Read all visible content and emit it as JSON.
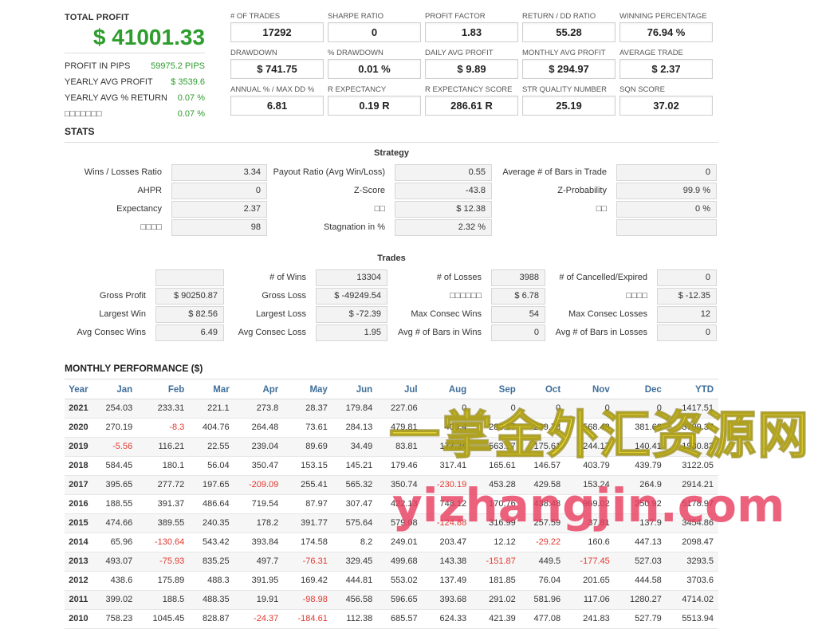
{
  "summary": {
    "total_profit_label": "TOTAL PROFIT",
    "total_profit_value": "$ 41001.33",
    "rows": [
      {
        "label": "PROFIT IN PIPS",
        "value": "59975.2 PIPS"
      },
      {
        "label": "YEARLY AVG PROFIT",
        "value": "$ 3539.6"
      },
      {
        "label": "YEARLY AVG % RETURN",
        "value": "0.07 %"
      },
      {
        "label": "□□□□□□□",
        "value": "0.07 %"
      }
    ]
  },
  "metrics": [
    {
      "label": "# OF TRADES",
      "value": "17292"
    },
    {
      "label": "SHARPE RATIO",
      "value": "0"
    },
    {
      "label": "PROFIT FACTOR",
      "value": "1.83"
    },
    {
      "label": "RETURN / DD RATIO",
      "value": "55.28"
    },
    {
      "label": "WINNING PERCENTAGE",
      "value": "76.94 %"
    },
    {
      "label": "DRAWDOWN",
      "value": "$ 741.75"
    },
    {
      "label": "% DRAWDOWN",
      "value": "0.01 %"
    },
    {
      "label": "DAILY AVG PROFIT",
      "value": "$ 9.89"
    },
    {
      "label": "MONTHLY AVG PROFIT",
      "value": "$ 294.97"
    },
    {
      "label": "AVERAGE TRADE",
      "value": "$ 2.37"
    },
    {
      "label": "ANNUAL % / MAX DD %",
      "value": "6.81"
    },
    {
      "label": "R EXPECTANCY",
      "value": "0.19 R"
    },
    {
      "label": "R EXPECTANCY SCORE",
      "value": "286.61 R"
    },
    {
      "label": "STR QUALITY NUMBER",
      "value": "25.19"
    },
    {
      "label": "SQN SCORE",
      "value": "37.02"
    }
  ],
  "stats": {
    "title": "STATS",
    "strategy_title": "Strategy",
    "strategy": [
      {
        "label": "Wins / Losses Ratio",
        "value": "3.34"
      },
      {
        "label": "Payout Ratio (Avg Win/Loss)",
        "value": "0.55"
      },
      {
        "label": "Average # of Bars in Trade",
        "value": "0"
      },
      {
        "label": "AHPR",
        "value": "0"
      },
      {
        "label": "Z-Score",
        "value": "-43.8"
      },
      {
        "label": "Z-Probability",
        "value": "99.9 %"
      },
      {
        "label": "Expectancy",
        "value": "2.37"
      },
      {
        "label": "□□",
        "value": "$ 12.38"
      },
      {
        "label": "□□",
        "value": "0 %"
      },
      {
        "label": "□□□□",
        "value": "98"
      },
      {
        "label": "Stagnation in %",
        "value": "2.32 %"
      },
      {
        "label": "",
        "value": ""
      }
    ],
    "trades_title": "Trades",
    "trades": [
      {
        "label": "",
        "value": ""
      },
      {
        "label": "# of Wins",
        "value": "13304"
      },
      {
        "label": "# of Losses",
        "value": "3988"
      },
      {
        "label": "# of Cancelled/Expired",
        "value": "0"
      },
      {
        "label": "Gross Profit",
        "value": "$ 90250.87"
      },
      {
        "label": "Gross Loss",
        "value": "$ -49249.54"
      },
      {
        "label": "□□□□□□",
        "value": "$ 6.78"
      },
      {
        "label": "□□□□",
        "value": "$ -12.35"
      },
      {
        "label": "Largest Win",
        "value": "$ 82.56"
      },
      {
        "label": "Largest Loss",
        "value": "$ -72.39"
      },
      {
        "label": "Max Consec Wins",
        "value": "54"
      },
      {
        "label": "Max Consec Losses",
        "value": "12"
      },
      {
        "label": "Avg Consec Wins",
        "value": "6.49"
      },
      {
        "label": "Avg Consec Loss",
        "value": "1.95"
      },
      {
        "label": "Avg # of Bars in Wins",
        "value": "0"
      },
      {
        "label": "Avg # of Bars in Losses",
        "value": "0"
      }
    ]
  },
  "monthly": {
    "title": "MONTHLY PERFORMANCE ($)",
    "headers": [
      "Year",
      "Jan",
      "Feb",
      "Mar",
      "Apr",
      "May",
      "Jun",
      "Jul",
      "Aug",
      "Sep",
      "Oct",
      "Nov",
      "Dec",
      "YTD"
    ],
    "rows": [
      [
        "2021",
        "254.03",
        "233.31",
        "221.1",
        "273.8",
        "28.37",
        "179.84",
        "227.06",
        "0",
        "0",
        "0",
        "0",
        "0",
        "1417.51"
      ],
      [
        "2020",
        "270.19",
        "-8.3",
        "404.76",
        "264.48",
        "73.61",
        "284.13",
        "479.81",
        "400.4",
        "280.37",
        "299.78",
        "568.48",
        "381.66",
        "3709.37"
      ],
      [
        "2019",
        "-5.56",
        "116.21",
        "22.55",
        "239.04",
        "89.69",
        "34.49",
        "83.81",
        "177.24",
        "563.17",
        "175.61",
        "244.17",
        "140.41",
        "1930.83"
      ],
      [
        "2018",
        "584.45",
        "180.1",
        "56.04",
        "350.47",
        "153.15",
        "145.21",
        "179.46",
        "317.41",
        "165.61",
        "146.57",
        "403.79",
        "439.79",
        "3122.05"
      ],
      [
        "2017",
        "395.65",
        "277.72",
        "197.65",
        "-209.09",
        "255.41",
        "565.32",
        "350.74",
        "-230.19",
        "453.28",
        "429.58",
        "153.24",
        "264.9",
        "2914.21"
      ],
      [
        "2016",
        "188.55",
        "391.37",
        "486.64",
        "719.54",
        "87.97",
        "307.47",
        "422.13",
        "748.12",
        "170.76",
        "438.48",
        "969.02",
        "250.92",
        "5178.97"
      ],
      [
        "2015",
        "474.66",
        "389.55",
        "240.35",
        "178.2",
        "391.77",
        "575.64",
        "579.08",
        "-124.88",
        "316.99",
        "257.59",
        "37.81",
        "137.9",
        "3454.86"
      ],
      [
        "2014",
        "65.96",
        "-130.64",
        "543.42",
        "393.84",
        "174.58",
        "8.2",
        "249.01",
        "203.47",
        "12.12",
        "-29.22",
        "160.6",
        "447.13",
        "2098.47"
      ],
      [
        "2013",
        "493.07",
        "-75.93",
        "835.25",
        "497.7",
        "-76.31",
        "329.45",
        "499.68",
        "143.38",
        "-151.87",
        "449.5",
        "-177.45",
        "527.03",
        "3293.5"
      ],
      [
        "2012",
        "438.6",
        "175.89",
        "488.3",
        "391.95",
        "169.42",
        "444.81",
        "553.02",
        "137.49",
        "181.85",
        "76.04",
        "201.65",
        "444.58",
        "3703.6"
      ],
      [
        "2011",
        "399.02",
        "188.5",
        "488.35",
        "19.91",
        "-98.98",
        "456.58",
        "596.65",
        "393.68",
        "291.02",
        "581.96",
        "117.06",
        "1280.27",
        "4714.02"
      ],
      [
        "2010",
        "758.23",
        "1045.45",
        "828.87",
        "-24.37",
        "-184.61",
        "112.38",
        "685.57",
        "624.33",
        "421.39",
        "477.08",
        "241.83",
        "527.79",
        "5513.94"
      ]
    ]
  },
  "watermark": {
    "line1": "一掌金外汇资源网",
    "line2": "yizhangjin.com"
  },
  "colors": {
    "positive": "#2e9d2e",
    "negative": "#e2382f",
    "header_blue": "#3f6e9a"
  }
}
